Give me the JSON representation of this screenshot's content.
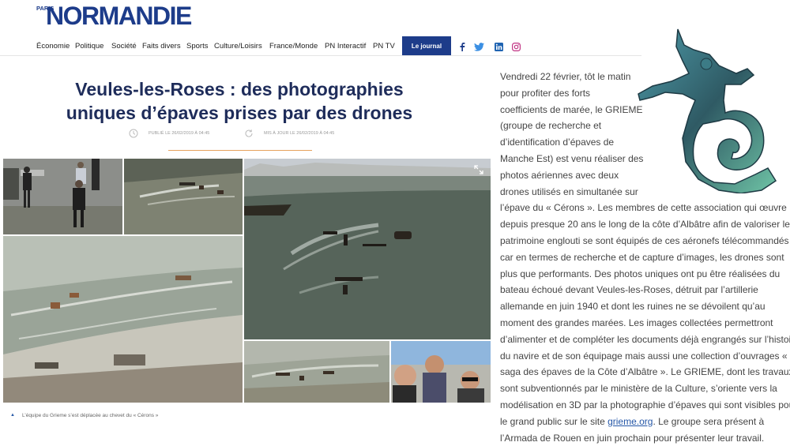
{
  "logo": {
    "small": "PARIS",
    "main": "NORMANDIE"
  },
  "nav": [
    "Économie",
    "Politique",
    "Société",
    "Faits divers",
    "Sports",
    "Culture/Loisirs",
    "France/Monde",
    "PN Interactif",
    "PN TV"
  ],
  "journal_button": "Le journal",
  "social": [
    "facebook",
    "twitter",
    "linkedin",
    "instagram"
  ],
  "article": {
    "title_line1": "Veules-les-Roses : des photographies",
    "title_line2": "uniques d’épaves prises par des drones",
    "published": "PUBLIÉ LE 26/02/2019 À 04:45",
    "updated": "MIS À JOUR LE 26/02/2019 À 04:45",
    "caption": "L’équipe du Grieme s’est déplacée au chevet du « Cérons »"
  },
  "body_lines_narrow": [
    "Vendredi 22 février, tôt le matin",
    "pour profiter des forts",
    "coefficients de marée, le GRIEME",
    "(groupe de recherche et",
    "d’identification d’épaves de",
    "Manche Est) est venu réaliser des",
    "photos aériennes avec deux",
    "drones utilisés en simultanée sur"
  ],
  "body_lines_wide": [
    "l’épave du « Cérons ». Les membres de cette association qui œuvre",
    "depuis presque 20 ans le long de la côte d’Albâtre afin de valoriser le",
    "patrimoine englouti se sont équipés de ces aéronefs télécommandés",
    "car en termes de recherche et de capture d’images, les drones sont",
    "plus que performants. Des photos uniques ont pu être réalisées du",
    "bateau échoué devant Veules-les-Roses, détruit par l’artillerie",
    "allemande en juin 1940 et dont les ruines ne se dévoilent qu’au",
    "moment des grandes marées. Les images collectées permettront",
    "d’alimenter et de compléter les documents déjà engrangés sur l’histoire",
    "du navire et de son équipage mais aussi une collection d’ouvrages « La",
    "saga des épaves de la Côte d’Albâtre ». Le GRIEME, dont les travaux",
    "sont subventionnés par le ministère de la Culture, s’oriente vers la",
    "modélisation en 3D par la photographie d’épaves qui sont visibles pour"
  ],
  "body_link_line": {
    "before": "le grand public sur le site ",
    "link": "grieme.org",
    "after": ". Le groupe sera présent à"
  },
  "body_last_line": "l’Armada de Rouen en juin prochain pour présenter leur travail.",
  "colors": {
    "brand": "#1d3c8a",
    "title": "#1e2c5a",
    "accent": "#e6a25d",
    "link": "#2557a7"
  }
}
